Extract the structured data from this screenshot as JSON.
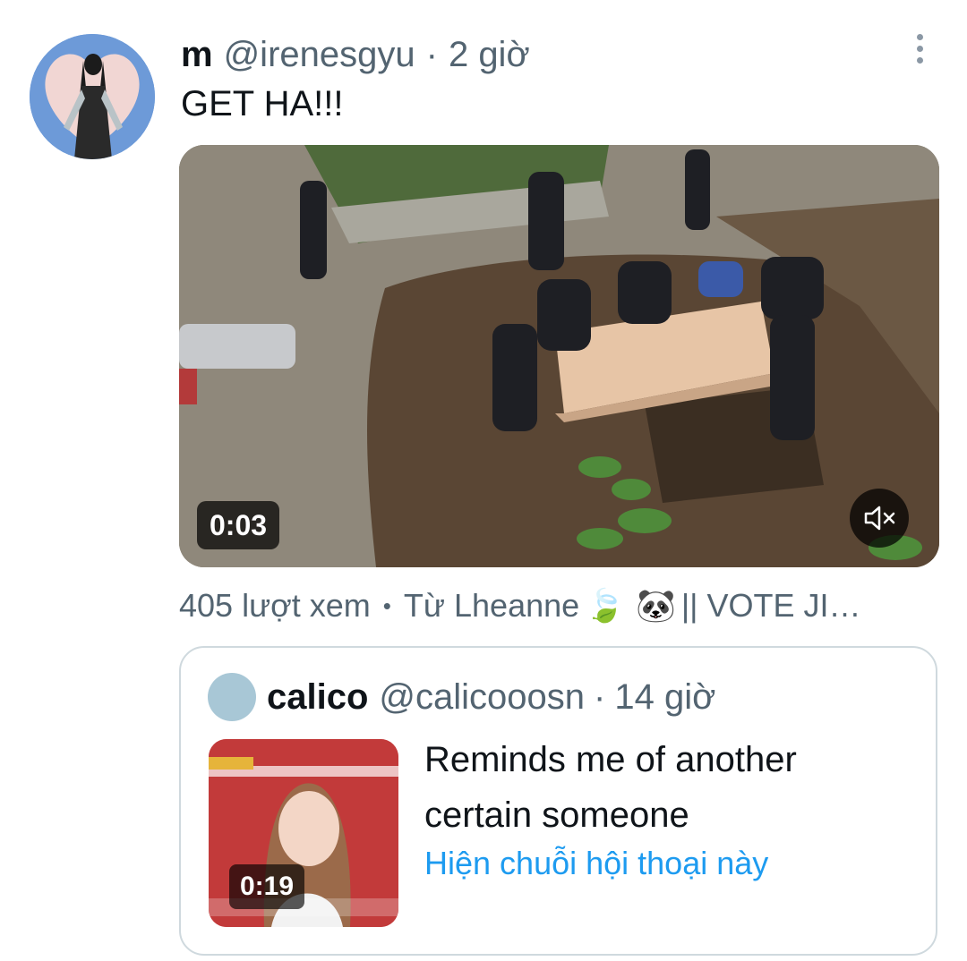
{
  "tweet": {
    "display_name": "m",
    "handle": "@irenesgyu",
    "separator": "·",
    "time": "2 giờ",
    "text": "GET HA!!!",
    "more_icon": "more-vertical-icon",
    "video": {
      "duration": "0:03",
      "mute_icon": "volume-muted-icon"
    },
    "meta": {
      "views": "405 lượt xem",
      "bullet": "•",
      "source": "Từ Lheanne",
      "source_suffix": "|| VOTE JI…",
      "emojis": [
        "🍃",
        "🐼"
      ]
    }
  },
  "quoted": {
    "display_name": "calico",
    "handle": "@calicooosn",
    "separator": "·",
    "time": "14 giờ",
    "text": "Reminds me of another certain someone",
    "thumb_duration": "0:19",
    "thread_link": "Hiện chuỗi hội thoại này"
  },
  "colors": {
    "primary_text": "#0f1419",
    "secondary_text": "#536471",
    "link": "#1d9bf0",
    "border": "#cfd9de"
  }
}
